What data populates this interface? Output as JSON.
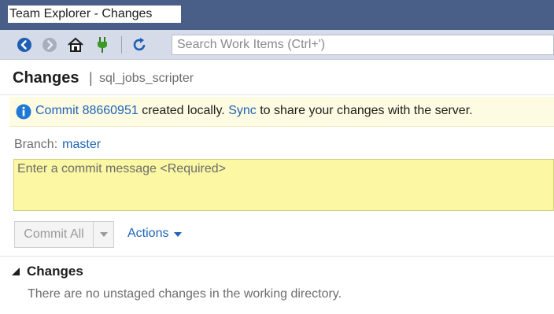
{
  "window": {
    "title": "Team Explorer - Changes"
  },
  "toolbar": {
    "icons": [
      "back-icon",
      "forward-icon",
      "home-icon",
      "connect-icon",
      "refresh-icon"
    ],
    "search_placeholder": "Search Work Items (Ctrl+')"
  },
  "header": {
    "title": "Changes",
    "separator": "|",
    "repo": "sql_jobs_scripter"
  },
  "info": {
    "prefix": "Commit",
    "commit_id": "88660951",
    "middle": "created locally.",
    "sync_link": "Sync",
    "suffix": "to share your changes with the server."
  },
  "branch": {
    "label": "Branch:",
    "name": "master"
  },
  "commit_message": {
    "placeholder": "Enter a commit message <Required>"
  },
  "buttons": {
    "commit_all": "Commit All",
    "actions": "Actions"
  },
  "changes_section": {
    "title": "Changes",
    "empty_text": "There are no unstaged changes in the working directory."
  },
  "colors": {
    "titlebar": "#4a5f88",
    "toolbar": "#d6dbe9",
    "link": "#1e63b8",
    "info_bg": "#fdfbe1",
    "commit_box_bg": "#fbf7a2"
  }
}
